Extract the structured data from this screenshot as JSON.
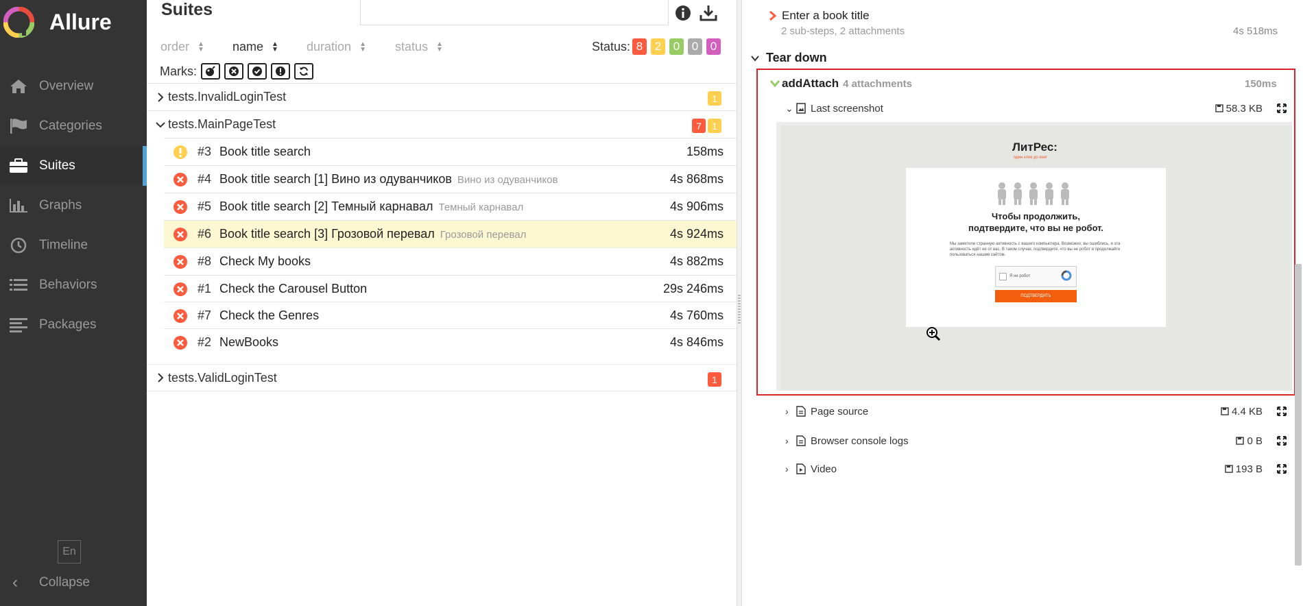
{
  "app": {
    "name": "Allure"
  },
  "sidebar": {
    "items": [
      {
        "label": "Overview",
        "icon": "home-icon"
      },
      {
        "label": "Categories",
        "icon": "flag-icon"
      },
      {
        "label": "Suites",
        "icon": "briefcase-icon",
        "active": true
      },
      {
        "label": "Graphs",
        "icon": "bar-chart-icon"
      },
      {
        "label": "Timeline",
        "icon": "clock-icon"
      },
      {
        "label": "Behaviors",
        "icon": "list-icon"
      },
      {
        "label": "Packages",
        "icon": "align-left-icon"
      }
    ],
    "language": "En",
    "collapse": "Collapse"
  },
  "suites": {
    "title": "Suites",
    "search": {
      "value": "",
      "placeholder": ""
    },
    "sort": {
      "order": "order",
      "name": "name",
      "duration": "duration",
      "status": "status",
      "active": "name"
    },
    "status_label": "Status:",
    "status_counts": [
      {
        "value": "8",
        "color": "#fd5a3e"
      },
      {
        "value": "2",
        "color": "#ffd050"
      },
      {
        "value": "0",
        "color": "#97cc64"
      },
      {
        "value": "0",
        "color": "#aaaaaa"
      },
      {
        "value": "0",
        "color": "#d35ebe"
      }
    ],
    "marks_label": "Marks:",
    "marks": [
      "flaky-icon",
      "new-failed-icon",
      "new-passed-icon",
      "new-broken-icon",
      "retries-icon"
    ],
    "groups": [
      {
        "name": "tests.InvalidLoginTest",
        "expanded": false,
        "badges": [
          {
            "value": "1",
            "color": "#ffd050"
          }
        ]
      },
      {
        "name": "tests.MainPageTest",
        "expanded": true,
        "badges": [
          {
            "value": "7",
            "color": "#fd5a3e"
          },
          {
            "value": "1",
            "color": "#ffd050"
          }
        ]
      },
      {
        "name": "tests.ValidLoginTest",
        "expanded": false,
        "badges": [
          {
            "value": "1",
            "color": "#fd5a3e"
          }
        ]
      }
    ],
    "tests": [
      {
        "status": "broken",
        "num": "#3",
        "name": "Book title search",
        "param": "",
        "duration": "158ms"
      },
      {
        "status": "failed",
        "num": "#4",
        "name": "Book title search [1] Вино из одуванчиков",
        "param": "Вино из одуванчиков",
        "duration": "4s 868ms"
      },
      {
        "status": "failed",
        "num": "#5",
        "name": "Book title search [2] Темный карнавал",
        "param": "Темный карнавал",
        "duration": "4s 906ms"
      },
      {
        "status": "failed",
        "num": "#6",
        "name": "Book title search [3] Грозовой перевал",
        "param": "Грозовой перевал",
        "duration": "4s 924ms",
        "selected": true
      },
      {
        "status": "failed",
        "num": "#8",
        "name": "Check My books",
        "param": "",
        "duration": "4s 882ms"
      },
      {
        "status": "failed",
        "num": "#1",
        "name": "Check the Carousel Button",
        "param": "",
        "duration": "29s 246ms"
      },
      {
        "status": "failed",
        "num": "#7",
        "name": "Check the Genres",
        "param": "",
        "duration": "4s 760ms"
      },
      {
        "status": "failed",
        "num": "#2",
        "name": "NewBooks",
        "param": "",
        "duration": "4s 846ms"
      }
    ]
  },
  "detail": {
    "step": {
      "name": "Enter a book title",
      "sub": "2 sub-steps, 2 attachments",
      "duration": "4s 518ms"
    },
    "teardown": "Tear down",
    "add_attach": {
      "name": "addAttach",
      "sub": "4 attachments",
      "duration": "150ms"
    },
    "attachments": [
      {
        "name": "Last screenshot",
        "size": "58.3 KB",
        "expanded": true
      },
      {
        "name": "Page source",
        "size": "4.4 KB"
      },
      {
        "name": "Browser console logs",
        "size": "0 B"
      },
      {
        "name": "Video",
        "size": "193 B"
      }
    ],
    "screenshot": {
      "logo": "ЛитРес:",
      "tagline": "один клик до книг",
      "heading_1": "Чтобы продолжить,",
      "heading_2": "подтвердите, что вы не робот.",
      "body": "Мы заметили странную активность с вашего компьютера. Возможно, вы ошиблись, и эта активность идёт не от вас. В таком случае, подтвердите, что вы не робот и продолжайте пользоваться нашим сайтом.",
      "captcha_label": "Я не робот",
      "button": "ПОДТВЕРДИТЬ"
    }
  }
}
